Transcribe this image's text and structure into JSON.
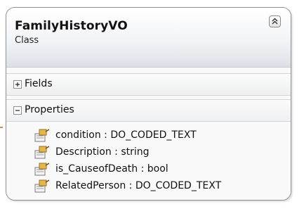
{
  "class_box": {
    "title": "FamilyHistoryVO",
    "subtitle": "Class",
    "sections": {
      "fields": {
        "label": "Fields",
        "expanded": false
      },
      "properties": {
        "label": "Properties",
        "expanded": true,
        "items": [
          "condition : DO_CODED_TEXT",
          "Description : string",
          "is_CauseofDeath : bool",
          "RelatedPerson : DO_CODED_TEXT"
        ]
      }
    }
  },
  "colors": {
    "border": "#8e8e8e",
    "header_gradient_end": "#dde0e6",
    "property_icon": "#c79a3a"
  }
}
